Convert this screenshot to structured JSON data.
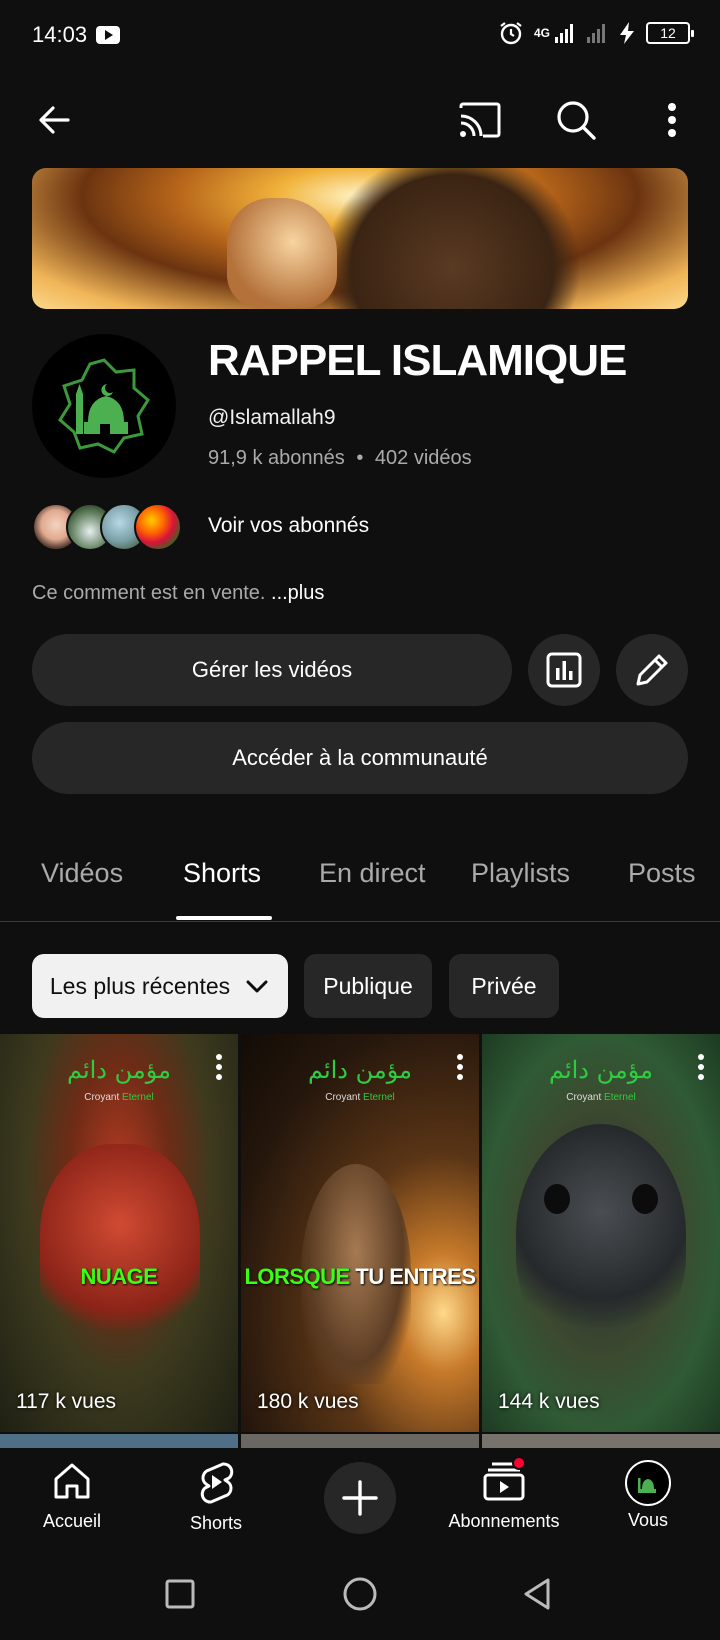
{
  "status_bar": {
    "time": "14:03",
    "network": "4G",
    "battery": "12"
  },
  "top_bar": {
    "icons": [
      "back-arrow-icon",
      "cast-icon",
      "search-icon",
      "more-vert-icon"
    ]
  },
  "channel": {
    "title": "RAPPEL ISLAMIQUE",
    "handle": "@Islamallah9",
    "subscribers": "91,9 k abonnés",
    "separator": "•",
    "videos": "402 vidéos",
    "see_subscribers": "Voir vos abonnés",
    "description": "Ce comment est en vente.",
    "more": "...plus"
  },
  "actions": {
    "manage_videos": "Gérer les vidéos",
    "community": "Accéder à la communauté"
  },
  "tabs": [
    {
      "label": "Vidéos"
    },
    {
      "label": "Shorts",
      "active": true
    },
    {
      "label": "En direct"
    },
    {
      "label": "Playlists"
    },
    {
      "label": "Posts"
    }
  ],
  "filters": {
    "sort": "Les plus récentes",
    "public": "Publique",
    "private": "Privée"
  },
  "shorts": [
    {
      "caption": "NUAGE",
      "views": "117 k vues",
      "brand": "Croyant",
      "brand_accent": "Eternel"
    },
    {
      "caption_a": "LORSQUE",
      "caption_b": "TU ENTRES",
      "views": "180 k vues",
      "brand": "Croyant",
      "brand_accent": "Eternel"
    },
    {
      "views": "144 k vues",
      "brand": "Croyant",
      "brand_accent": "Eternel"
    }
  ],
  "bottom_nav": {
    "home": "Accueil",
    "shorts": "Shorts",
    "subscriptions": "Abonnements",
    "you": "Vous"
  },
  "colors": {
    "background": "#0f0f0f",
    "surface": "#272727",
    "accent_red": "#ff0033",
    "brand_green": "#2ecc40"
  }
}
